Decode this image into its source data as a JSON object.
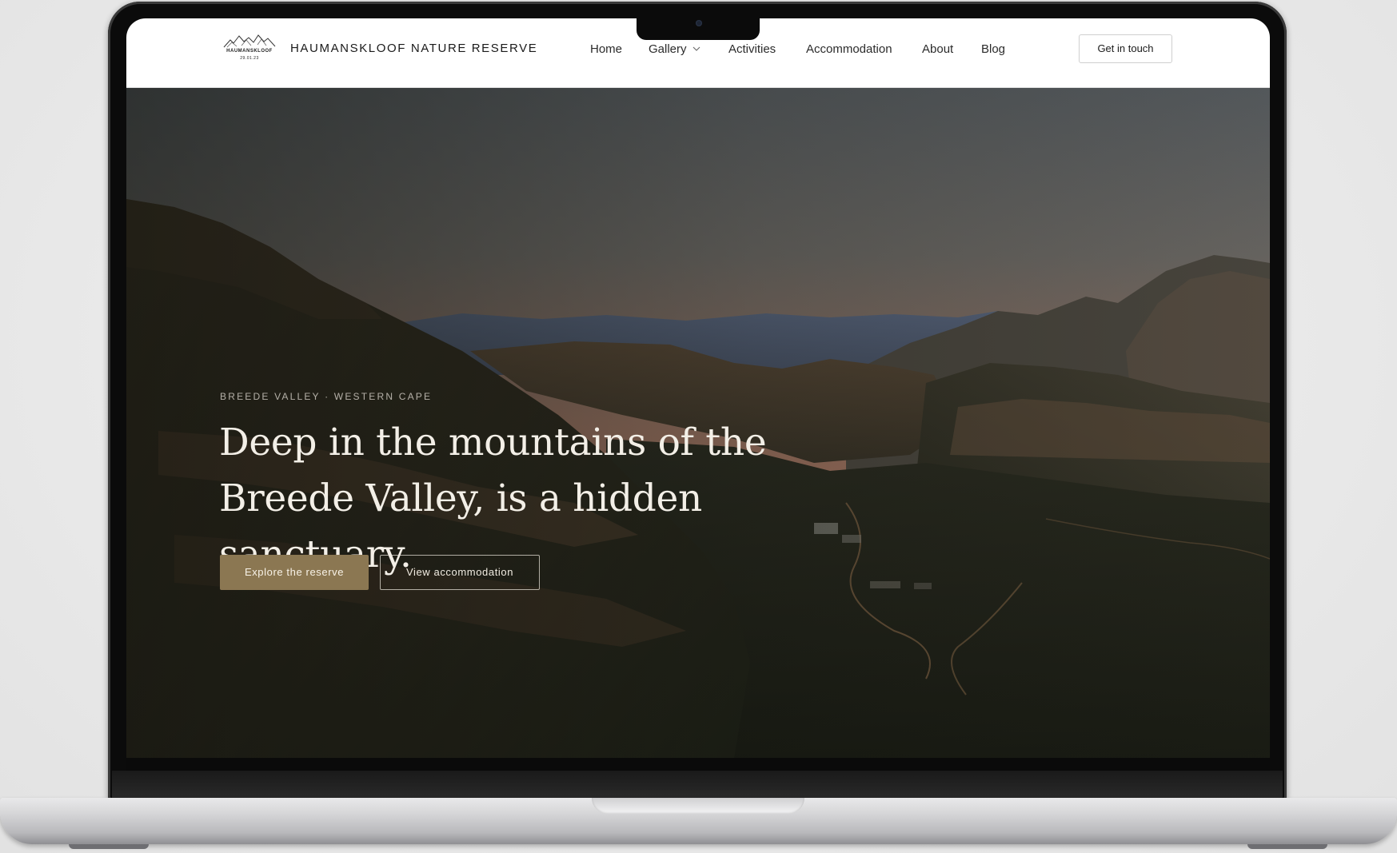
{
  "header": {
    "logo": {
      "name_small": "HAUMANSKLOOF",
      "date_small": "29.01.23"
    },
    "site_title": "HAUMANSKLOOF NATURE RESERVE",
    "nav": {
      "home": "Home",
      "gallery": "Gallery",
      "activities": "Activities",
      "accommodation": "Accommodation",
      "about": "About",
      "blog": "Blog"
    },
    "cta_label": "Get in touch"
  },
  "hero": {
    "eyebrow": "BREEDE VALLEY · WESTERN CAPE",
    "heading_line_1": "Deep in the mountains of the",
    "heading_line_2": "Breede Valley, is a hidden sanctuary.",
    "primary_button": "Explore the reserve",
    "secondary_button": "View accommodation"
  },
  "colors": {
    "accent": "#8b7752",
    "header_bg": "#ffffff",
    "hero_text": "#f3efe7"
  },
  "icons": {
    "gallery_dropdown": "chevron-down-icon",
    "logo": "mountain-range-logo"
  }
}
